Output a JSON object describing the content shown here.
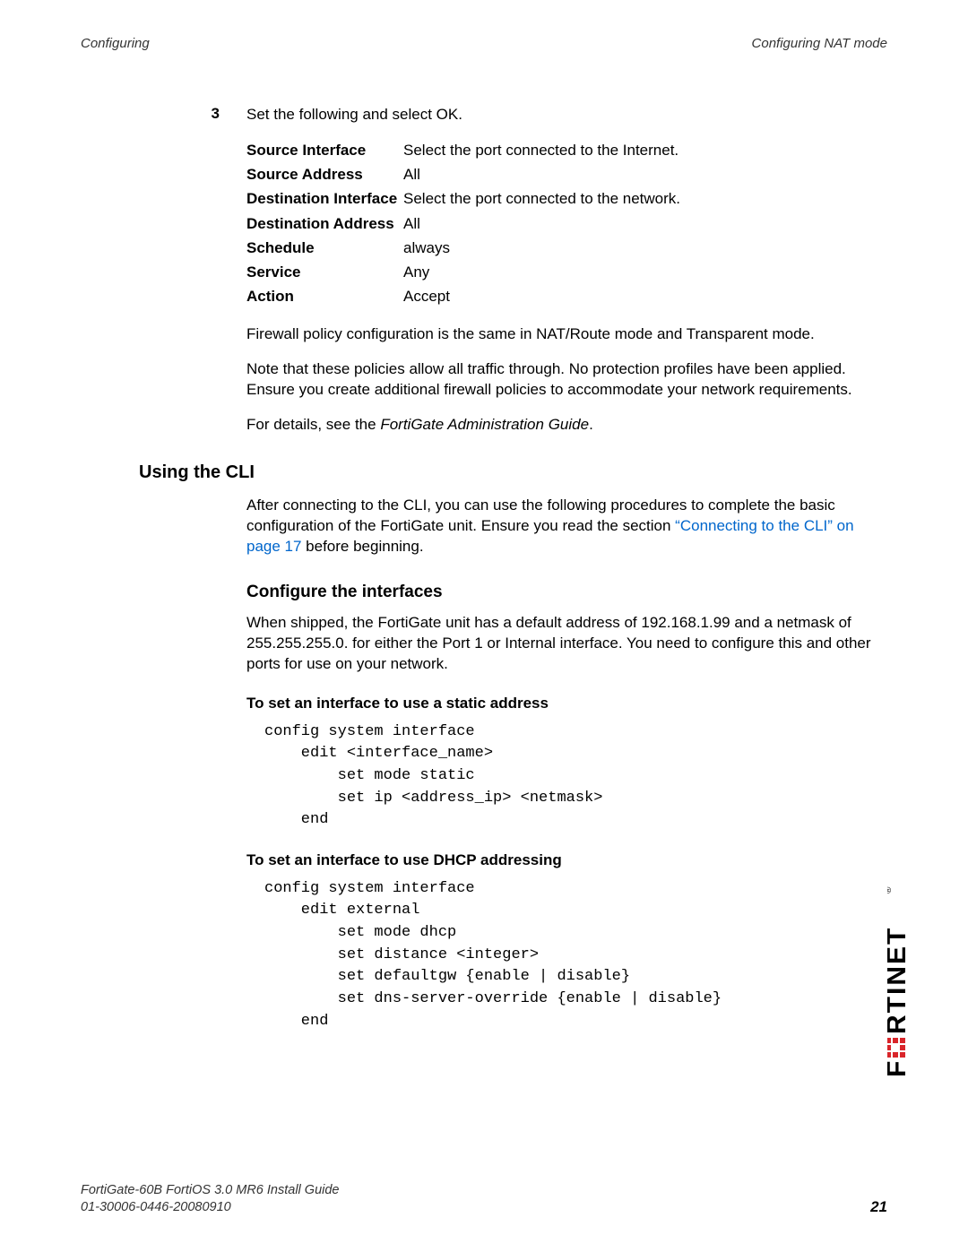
{
  "header": {
    "left": "Configuring",
    "right": "Configuring NAT mode"
  },
  "step": {
    "num": "3",
    "text": "Set the following and select OK."
  },
  "params": [
    {
      "label": "Source Interface",
      "value": "Select the port connected to the Internet."
    },
    {
      "label": "Source Address",
      "value": "All"
    },
    {
      "label": "Destination Interface",
      "value": "Select the port connected to the network."
    },
    {
      "label": "Destination Address",
      "value": "All"
    },
    {
      "label": "Schedule",
      "value": "always"
    },
    {
      "label": "Service",
      "value": "Any"
    },
    {
      "label": "Action",
      "value": "Accept"
    }
  ],
  "notes": {
    "p1": "Firewall policy configuration is the same in NAT/Route mode and Transparent mode.",
    "p2": "Note that these policies allow all traffic through. No protection profiles have been applied. Ensure you create additional firewall policies to accommodate your network requirements.",
    "p3_a": "For details, see the ",
    "p3_b": "FortiGate Administration Guide",
    "p3_c": "."
  },
  "cli": {
    "heading": "Using the CLI",
    "intro_a": "After connecting to the CLI, you can use the following procedures to complete the basic configuration of the FortiGate unit. Ensure you read the section ",
    "intro_link": "“Connecting to the CLI” on page 17",
    "intro_b": " before beginning.",
    "sub1": "Configure the interfaces",
    "sub1_text": "When shipped, the FortiGate unit has a default address of 192.168.1.99 and a netmask of 255.255.255.0. for either the Port 1 or Internal interface. You need to configure this and other ports for use on your network.",
    "task1": "To set an interface to use a static address",
    "code1": "config system interface\n    edit <interface_name>\n        set mode static\n        set ip <address_ip> <netmask>\n    end",
    "task2": "To set an interface to use DHCP addressing",
    "code2": "config system interface\n    edit external\n        set mode dhcp\n        set distance <integer>\n        set defaultgw {enable | disable}\n        set dns-server-override {enable | disable}\n    end"
  },
  "footer": {
    "line1": "FortiGate-60B FortiOS 3.0 MR6 Install Guide",
    "line2": "01-30006-0446-20080910",
    "page": "21"
  }
}
